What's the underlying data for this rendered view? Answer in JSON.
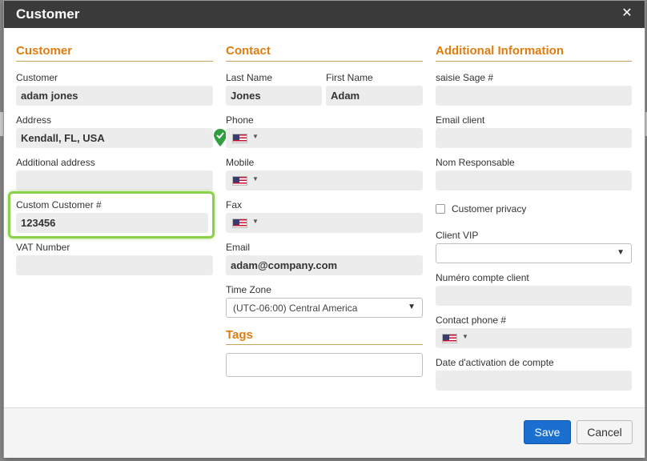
{
  "modal": {
    "title": "Customer",
    "close_glyph": "✕",
    "close_icon": "close-icon"
  },
  "customer_section": {
    "title": "Customer",
    "customer_label": "Customer",
    "customer_value": "adam jones",
    "address_label": "Address",
    "address_value": "Kendall, FL, USA",
    "additional_address_label": "Additional address",
    "additional_address_value": "",
    "custom_number_label": "Custom Customer #",
    "custom_number_value": "123456",
    "vat_label": "VAT Number",
    "vat_value": ""
  },
  "contact_section": {
    "title": "Contact",
    "last_name_label": "Last Name",
    "last_name_value": "Jones",
    "first_name_label": "First Name",
    "first_name_value": "Adam",
    "phone_label": "Phone",
    "mobile_label": "Mobile",
    "fax_label": "Fax",
    "email_label": "Email",
    "email_value": "adam@company.com",
    "timezone_label": "Time Zone",
    "timezone_value": "(UTC-06:00) Central America",
    "country_flag_icon": "us-flag-icon",
    "caret_glyph": "▼"
  },
  "tags_section": {
    "title": "Tags",
    "value": ""
  },
  "additional_section": {
    "title": "Additional Information",
    "saisie_sage_label": "saisie Sage #",
    "email_client_label": "Email client",
    "nom_responsable_label": "Nom Responsable",
    "customer_privacy_label": "Customer privacy",
    "client_vip_label": "Client VIP",
    "client_vip_value": "",
    "numero_compte_label": "Numéro compte client",
    "contact_phone_label": "Contact phone #",
    "date_activation_label": "Date d'activation de compte"
  },
  "footer": {
    "save_label": "Save",
    "cancel_label": "Cancel"
  },
  "colors": {
    "section_title": "#e07d10",
    "highlight": "#8bd04a",
    "save_button": "#1a6fd1",
    "header_bg": "#3a3a3a",
    "verified_check": "#2e9e3e"
  }
}
